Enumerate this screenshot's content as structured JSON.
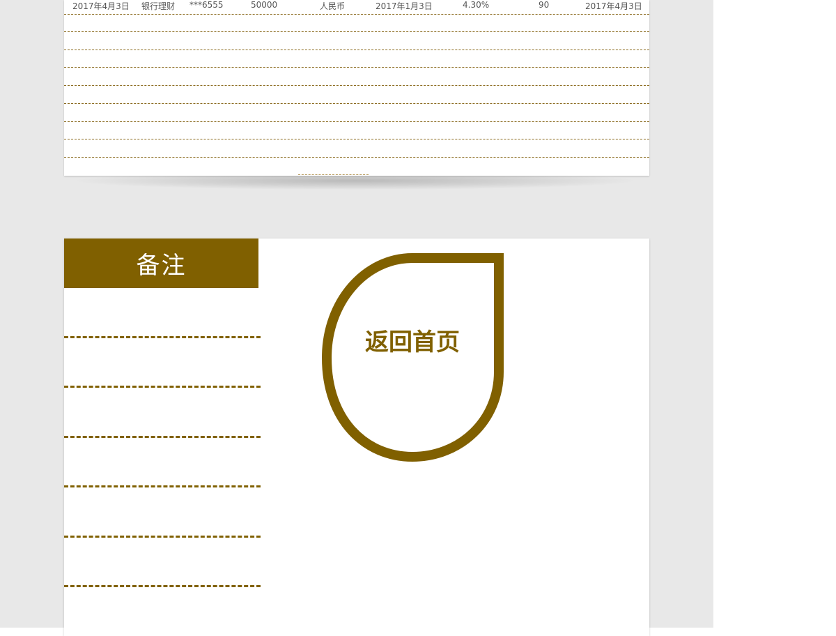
{
  "table": {
    "rows": [
      {
        "purchase_date": "2017年4月3日",
        "product_type": "银行理财",
        "account": "***6555",
        "amount": "50000",
        "currency": "人民币",
        "start_date": "2017年1月3日",
        "rate": "4.30%",
        "days": "90",
        "maturity_date": "2017年4月3日"
      }
    ],
    "blank_rows": 9
  },
  "notes": {
    "title": "备注",
    "line_count": 6
  },
  "home_button": {
    "label": "返回首页"
  },
  "colors": {
    "accent": "#806000",
    "workspace": "#e8e8e8",
    "sheet": "#ffffff",
    "text": "#555555"
  },
  "icons": {
    "home_shape": "teardrop-outline"
  }
}
